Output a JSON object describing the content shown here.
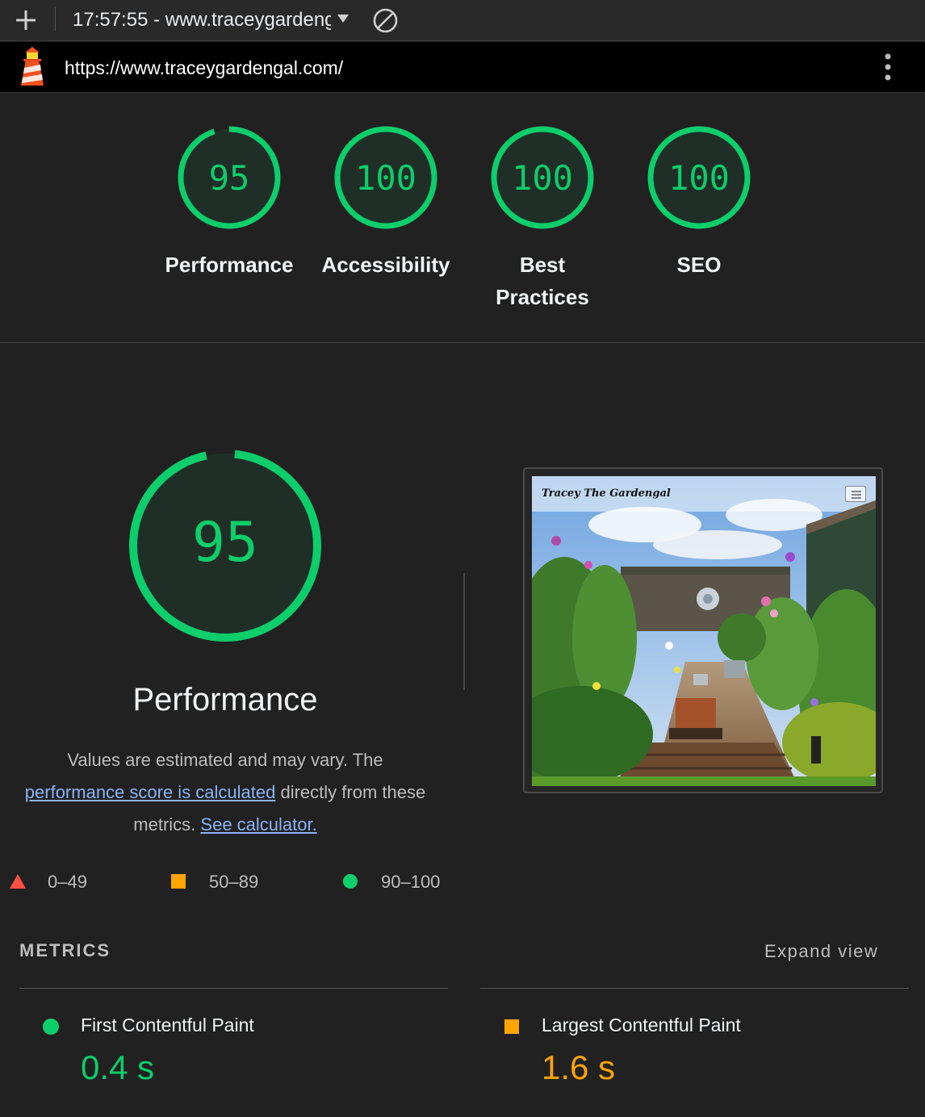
{
  "toolbar": {
    "report_label": "17:57:55 - www.traceygardeng"
  },
  "urlbar": {
    "url": "https://www.traceygardengal.com/"
  },
  "colors": {
    "pass": "#0cce6b",
    "average": "#ffa400",
    "fail": "#ff4e42",
    "link": "#8ab4f8"
  },
  "categories": [
    {
      "score": 95,
      "label": "Performance"
    },
    {
      "score": 100,
      "label": "Accessibility"
    },
    {
      "score": 100,
      "label": "Best Practices"
    },
    {
      "score": 100,
      "label": "SEO"
    }
  ],
  "performance": {
    "score": 95,
    "title": "Performance",
    "desc_part1": "Values are estimated and may vary. The ",
    "desc_link1": "performance score is calculated",
    "desc_part2": " directly from these metrics. ",
    "desc_link2": "See calculator."
  },
  "screenshot": {
    "caption": "Tracey The Gardengal"
  },
  "legend": {
    "fail": "0–49",
    "average": "50–89",
    "pass": "90–100"
  },
  "metrics": {
    "heading": "METRICS",
    "expand": "Expand view",
    "items": [
      {
        "name": "First Contentful Paint",
        "value": "0.4 s",
        "status": "pass"
      },
      {
        "name": "Largest Contentful Paint",
        "value": "1.6 s",
        "status": "average"
      }
    ]
  }
}
